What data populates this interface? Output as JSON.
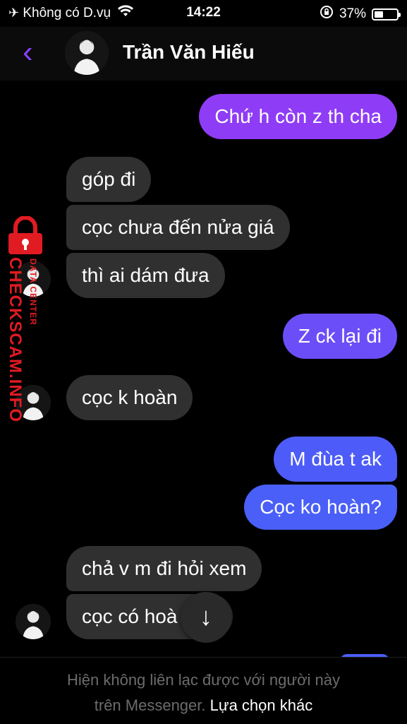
{
  "status_bar": {
    "carrier": "Không có D.vụ",
    "time": "14:22",
    "battery": "37%"
  },
  "header": {
    "contact_name": "Trần Văn Hiếu"
  },
  "messages": [
    {
      "dir": "out",
      "text": "Chứ h còn z th cha"
    },
    {
      "dir": "in",
      "text": "góp đi"
    },
    {
      "dir": "in",
      "text": "cọc chưa đến nửa giá"
    },
    {
      "dir": "in",
      "text": "thì ai dám đưa"
    },
    {
      "dir": "out",
      "text": "Z ck lại đi"
    },
    {
      "dir": "in",
      "text": "cọc k hoàn"
    },
    {
      "dir": "out",
      "text": "M đùa t ak"
    },
    {
      "dir": "out",
      "text": "Cọc ko hoàn?"
    },
    {
      "dir": "in",
      "text": "chả v m đi hỏi xem"
    },
    {
      "dir": "in",
      "text": "cọc có hoà"
    }
  ],
  "watermark": {
    "brand": "CHECKSCAM.INFO",
    "sub": "DATA CENTER"
  },
  "footer": {
    "line1": "Hiện không liên lạc được với người này",
    "line2": "trên Messenger.",
    "link": "Lựa chọn khác"
  },
  "colors": {
    "accent": "#8a3ffc",
    "incoming_bubble": "#303030",
    "out_purple": "#8f3cf6",
    "out_blue": "#4a5ff7",
    "watermark_red": "#e11b22"
  }
}
